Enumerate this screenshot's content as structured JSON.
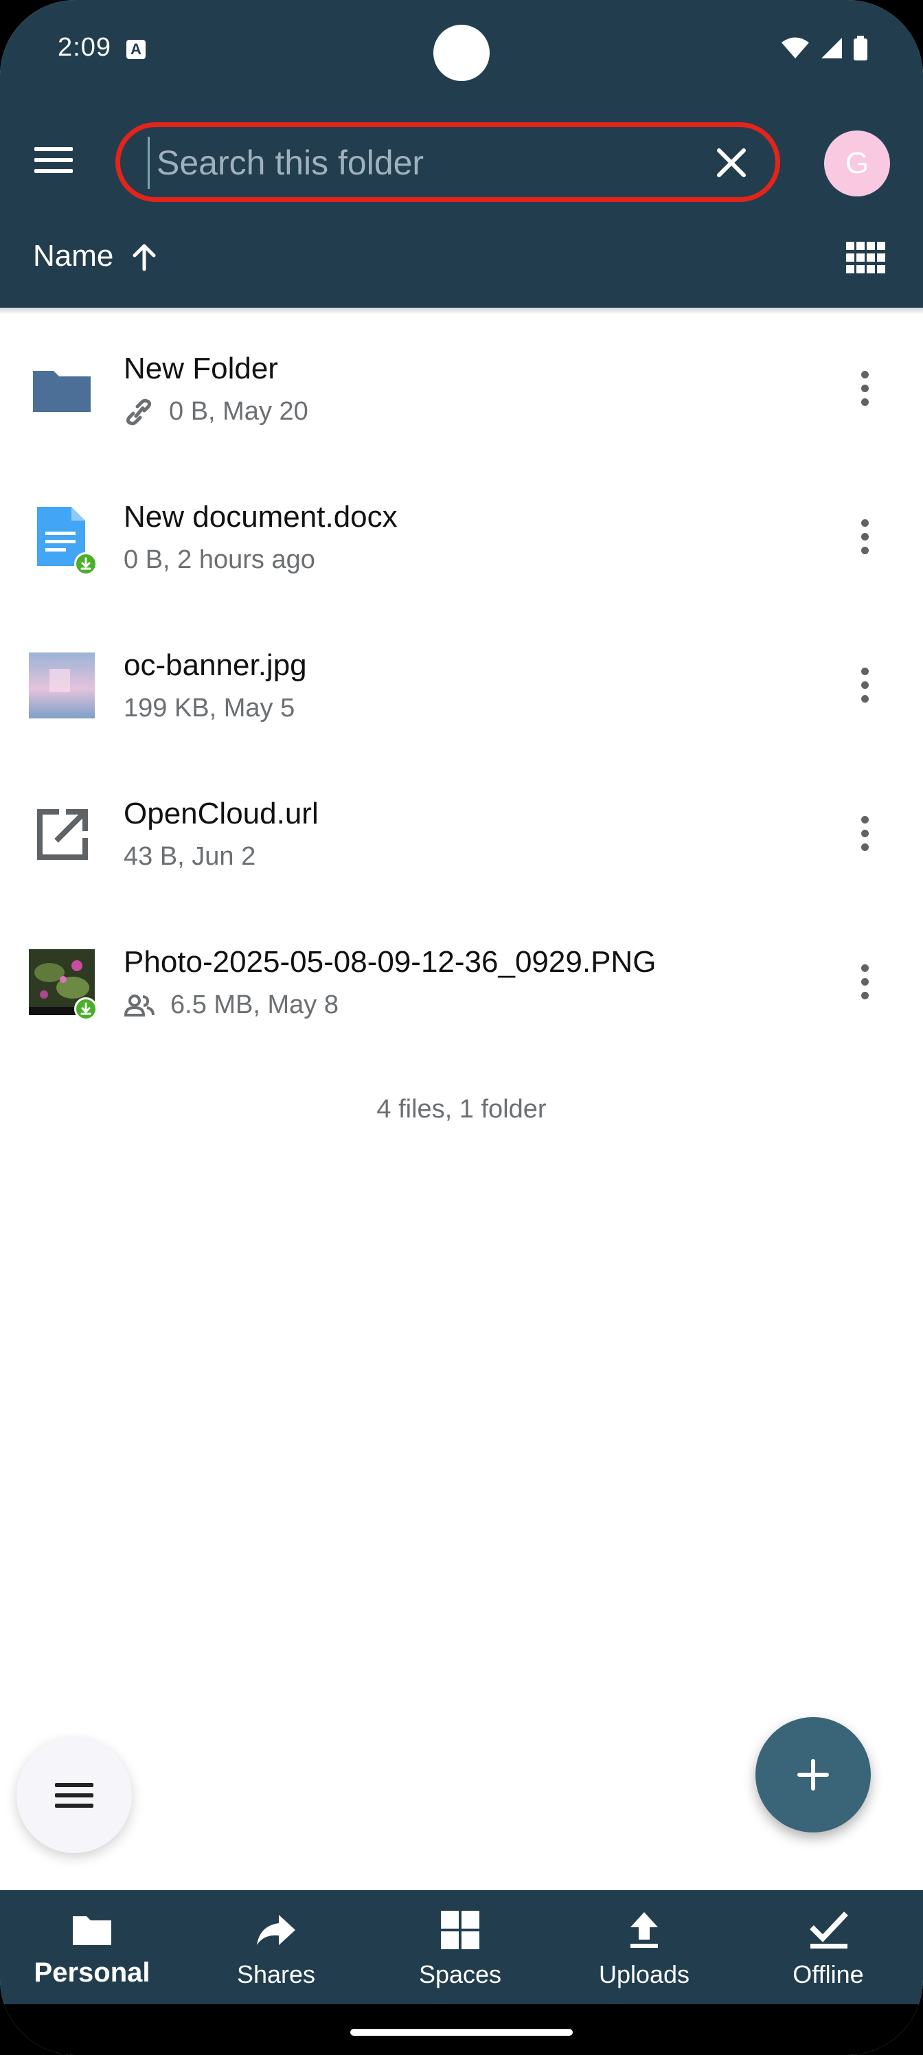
{
  "status": {
    "time": "2:09",
    "notification_icon": "A"
  },
  "search": {
    "placeholder": "Search this folder",
    "value": "",
    "outline_color": "#e3241b"
  },
  "account": {
    "avatar_initial": "G",
    "avatar_color": "#f8c9e1"
  },
  "sort": {
    "label": "Name",
    "direction": "ascending"
  },
  "files": [
    {
      "name": "New Folder",
      "meta": "0 B, May 20",
      "icon": "folder-icon",
      "meta_icon": "link-icon",
      "badge": false
    },
    {
      "name": "New document.docx",
      "meta": "0 B, 2 hours ago",
      "icon": "document-icon",
      "meta_icon": "",
      "badge": true
    },
    {
      "name": "oc-banner.jpg",
      "meta": "199 KB, May 5",
      "icon": "image-thumbnail",
      "meta_icon": "",
      "badge": false
    },
    {
      "name": "OpenCloud.url",
      "meta": "43 B, Jun 2",
      "icon": "external-link-icon",
      "meta_icon": "",
      "badge": false
    },
    {
      "name": "Photo-2025-05-08-09-12-36_0929.PNG",
      "meta": "6.5 MB, May 8",
      "icon": "photo-thumbnail",
      "meta_icon": "shared-people-icon",
      "badge": true
    }
  ],
  "summary": "4 files, 1 folder",
  "nav": [
    {
      "label": "Personal",
      "icon": "folder-icon",
      "active": true
    },
    {
      "label": "Shares",
      "icon": "share-arrow-icon",
      "active": false
    },
    {
      "label": "Spaces",
      "icon": "grid-icon",
      "active": false
    },
    {
      "label": "Uploads",
      "icon": "upload-icon",
      "active": false
    },
    {
      "label": "Offline",
      "icon": "check-icon",
      "active": false
    }
  ],
  "colors": {
    "primary": "#223e4e",
    "fab": "#3a6478",
    "folder": "#4c6f98",
    "doc": "#42a5f5",
    "badge": "#4caf2a"
  }
}
